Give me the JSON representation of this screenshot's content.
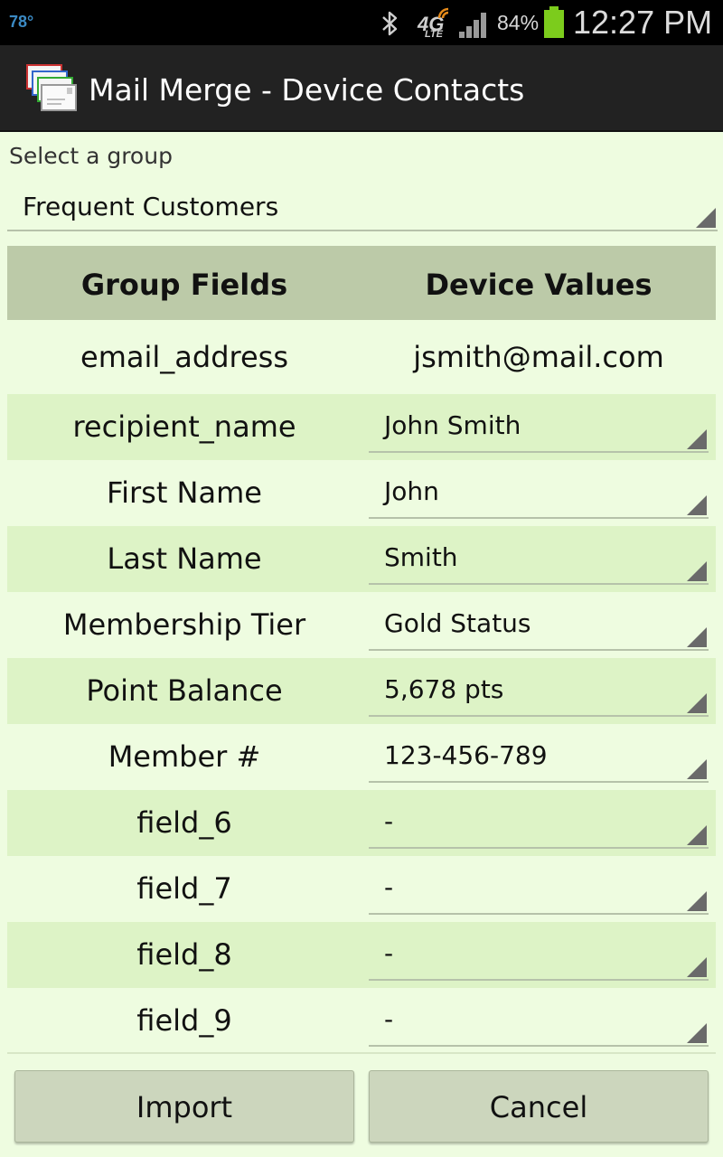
{
  "status_bar": {
    "temperature": "78°",
    "network_type": "4G",
    "network_sub": "LTE",
    "battery_percent": "84%",
    "battery_level": 0.84,
    "battery_color": "#7ccc1c",
    "time": "12:27 PM",
    "icons": [
      "bluetooth-icon",
      "lte-icon",
      "signal-icon",
      "battery-icon"
    ]
  },
  "app": {
    "title": "Mail Merge - Device Contacts",
    "icon": "mail-envelopes-icon"
  },
  "group": {
    "label": "Select a group",
    "selected": "Frequent Customers"
  },
  "table": {
    "headers": [
      "Group Fields",
      "Device Values"
    ],
    "email_row": {
      "field": "email_address",
      "value": "jsmith@mail.com"
    },
    "rows": [
      {
        "field": "recipient_name",
        "value": "John Smith"
      },
      {
        "field": "First Name",
        "value": "John"
      },
      {
        "field": "Last Name",
        "value": "Smith"
      },
      {
        "field": "Membership Tier",
        "value": "Gold Status"
      },
      {
        "field": "Point Balance",
        "value": "5,678 pts"
      },
      {
        "field": "Member #",
        "value": "123-456-789"
      },
      {
        "field": "field_6",
        "value": "-"
      },
      {
        "field": "field_7",
        "value": "-"
      },
      {
        "field": "field_8",
        "value": "-"
      },
      {
        "field": "field_9",
        "value": "-"
      }
    ]
  },
  "buttons": {
    "import": "Import",
    "cancel": "Cancel"
  },
  "colors": {
    "background": "#eefce0",
    "header_row": "#bccaa8",
    "alt_row": "#ddf3c6",
    "action_bar": "#222222",
    "button": "#ccd6bd"
  }
}
